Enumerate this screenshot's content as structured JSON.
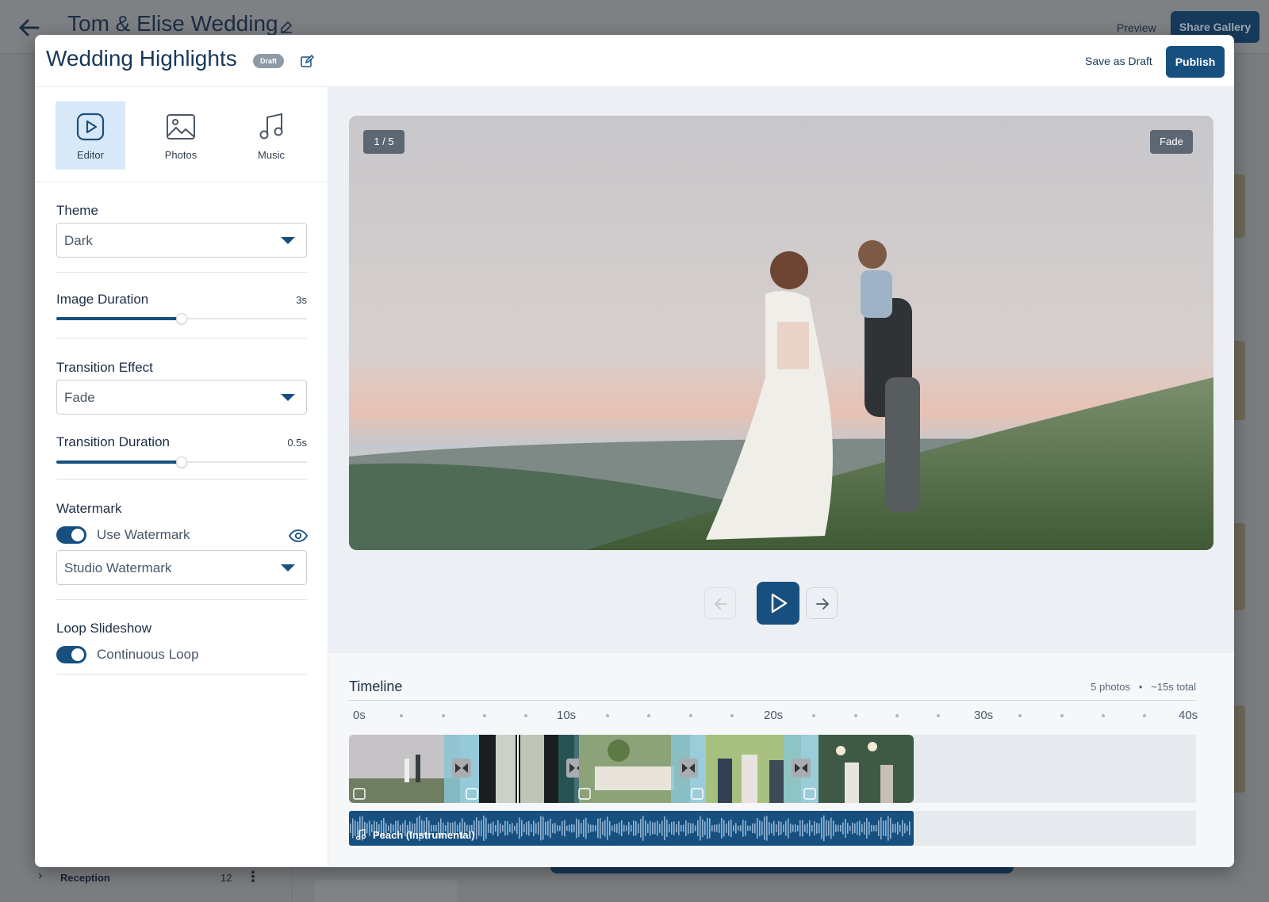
{
  "background": {
    "title": "Tom & Elise Wedding",
    "preview_label": "Preview",
    "share_label": "Share Gallery",
    "sidebar_row": {
      "label": "Reception",
      "count": "12"
    }
  },
  "modal": {
    "title": "Wedding Highlights",
    "status_badge": "Draft",
    "save_draft_label": "Save as Draft",
    "publish_label": "Publish"
  },
  "tabs": [
    {
      "label": "Editor",
      "icon": "play-square-icon",
      "active": true
    },
    {
      "label": "Photos",
      "icon": "image-icon",
      "active": false
    },
    {
      "label": "Music",
      "icon": "music-note-icon",
      "active": false
    }
  ],
  "settings": {
    "theme": {
      "label": "Theme",
      "value": "Dark"
    },
    "image_duration": {
      "label": "Image Duration",
      "value": "3s",
      "level": 0.5
    },
    "transition_effect": {
      "label": "Transition Effect",
      "value": "Fade"
    },
    "transition_duration": {
      "label": "Transition Duration",
      "value": "0.5s",
      "level": 0.5
    },
    "watermark": {
      "label": "Watermark",
      "toggle_label": "Use Watermark",
      "enabled": true,
      "value": "Studio Watermark"
    },
    "loop": {
      "label": "Loop Slideshow",
      "toggle_label": "Continuous Loop",
      "enabled": true
    }
  },
  "preview": {
    "counter": "1 / 5",
    "transition_badge": "Fade"
  },
  "timeline": {
    "title": "Timeline",
    "photo_count": "5 photos",
    "total": "~15s total",
    "ticks": [
      "0s",
      "10s",
      "20s",
      "30s",
      "40s"
    ],
    "audio_track": "Peach (Instrumental)"
  },
  "colors": {
    "primary": "#17507f",
    "active_tab": "#d7e9f8"
  }
}
